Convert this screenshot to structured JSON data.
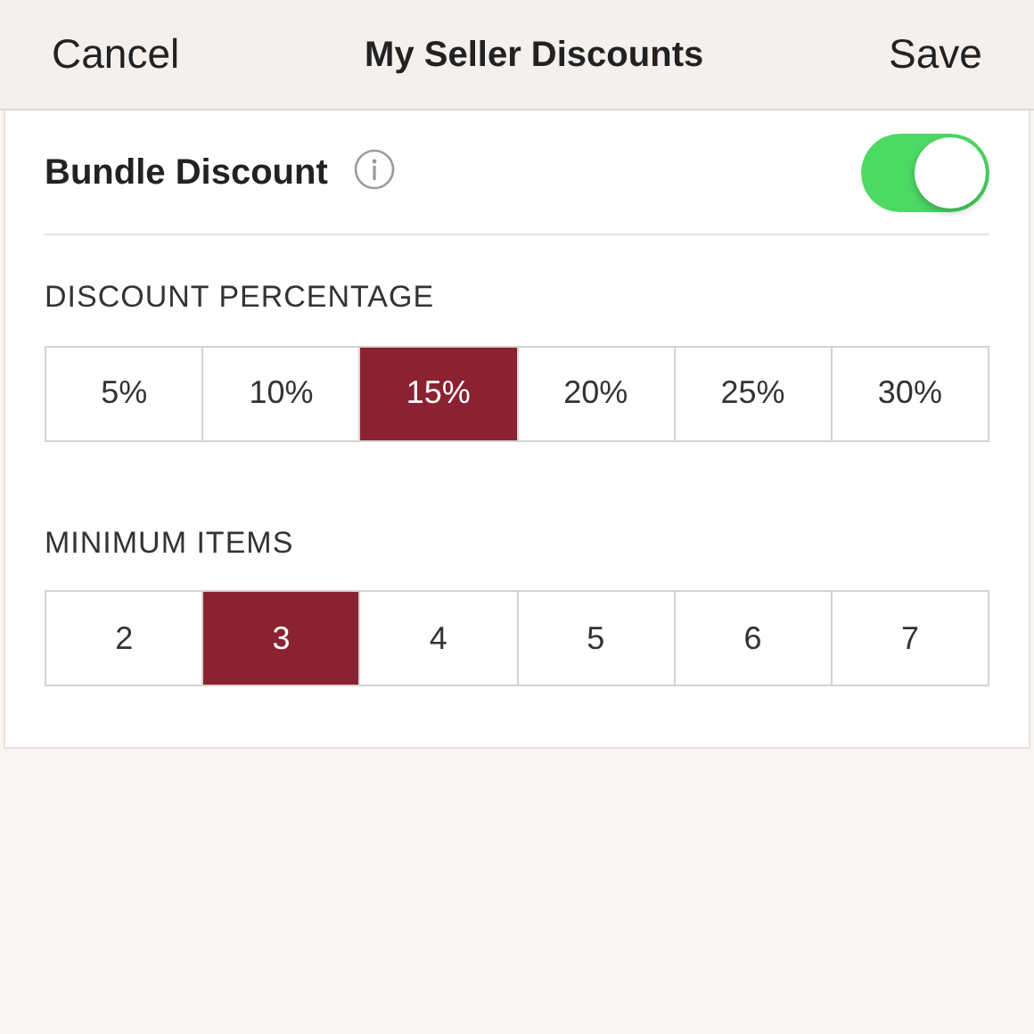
{
  "nav": {
    "cancel": "Cancel",
    "title": "My Seller Discounts",
    "save": "Save"
  },
  "bundle": {
    "label": "Bundle Discount",
    "on": true
  },
  "sections": [
    {
      "heading": "DISCOUNT PERCENTAGE",
      "options": [
        {
          "label": "5%",
          "selected": false
        },
        {
          "label": "10%",
          "selected": false
        },
        {
          "label": "15%",
          "selected": true
        },
        {
          "label": "20%",
          "selected": false
        },
        {
          "label": "25%",
          "selected": false
        },
        {
          "label": "30%",
          "selected": false
        }
      ]
    },
    {
      "heading": "MINIMUM ITEMS",
      "options": [
        {
          "label": "2",
          "selected": false
        },
        {
          "label": "3",
          "selected": true
        },
        {
          "label": "4",
          "selected": false
        },
        {
          "label": "5",
          "selected": false
        },
        {
          "label": "6",
          "selected": false
        },
        {
          "label": "7",
          "selected": false
        }
      ]
    }
  ]
}
